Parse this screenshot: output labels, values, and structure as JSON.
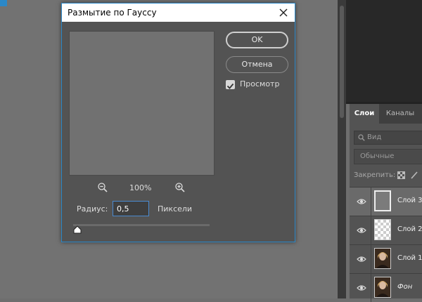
{
  "dialog": {
    "title": "Размытие по Гауссу",
    "zoom_level": "100%",
    "radius_label": "Радиус:",
    "radius_value": "0,5",
    "unit_label": "Пиксели",
    "ok_label": "OK",
    "cancel_label": "Отмена",
    "preview_label": "Просмотр",
    "preview_checked": true
  },
  "layers_panel": {
    "tabs": [
      {
        "label": "Слои",
        "active": true
      },
      {
        "label": "Каналы",
        "active": false
      }
    ],
    "search_placeholder": "Вид",
    "blend_mode": "Обычные",
    "lock_label": "Закрепить:",
    "layers": [
      {
        "name": "Слой 3",
        "thumb": "gray",
        "active": true
      },
      {
        "name": "Слой 2",
        "thumb": "transparent",
        "active": false
      },
      {
        "name": "Слой 1",
        "thumb": "photo",
        "active": false
      },
      {
        "name": "Фон",
        "thumb": "photo",
        "active": false
      }
    ]
  },
  "colors": {
    "accent": "#2b88c8",
    "dialog_bg": "#535353",
    "canvas_bg": "#727272"
  }
}
